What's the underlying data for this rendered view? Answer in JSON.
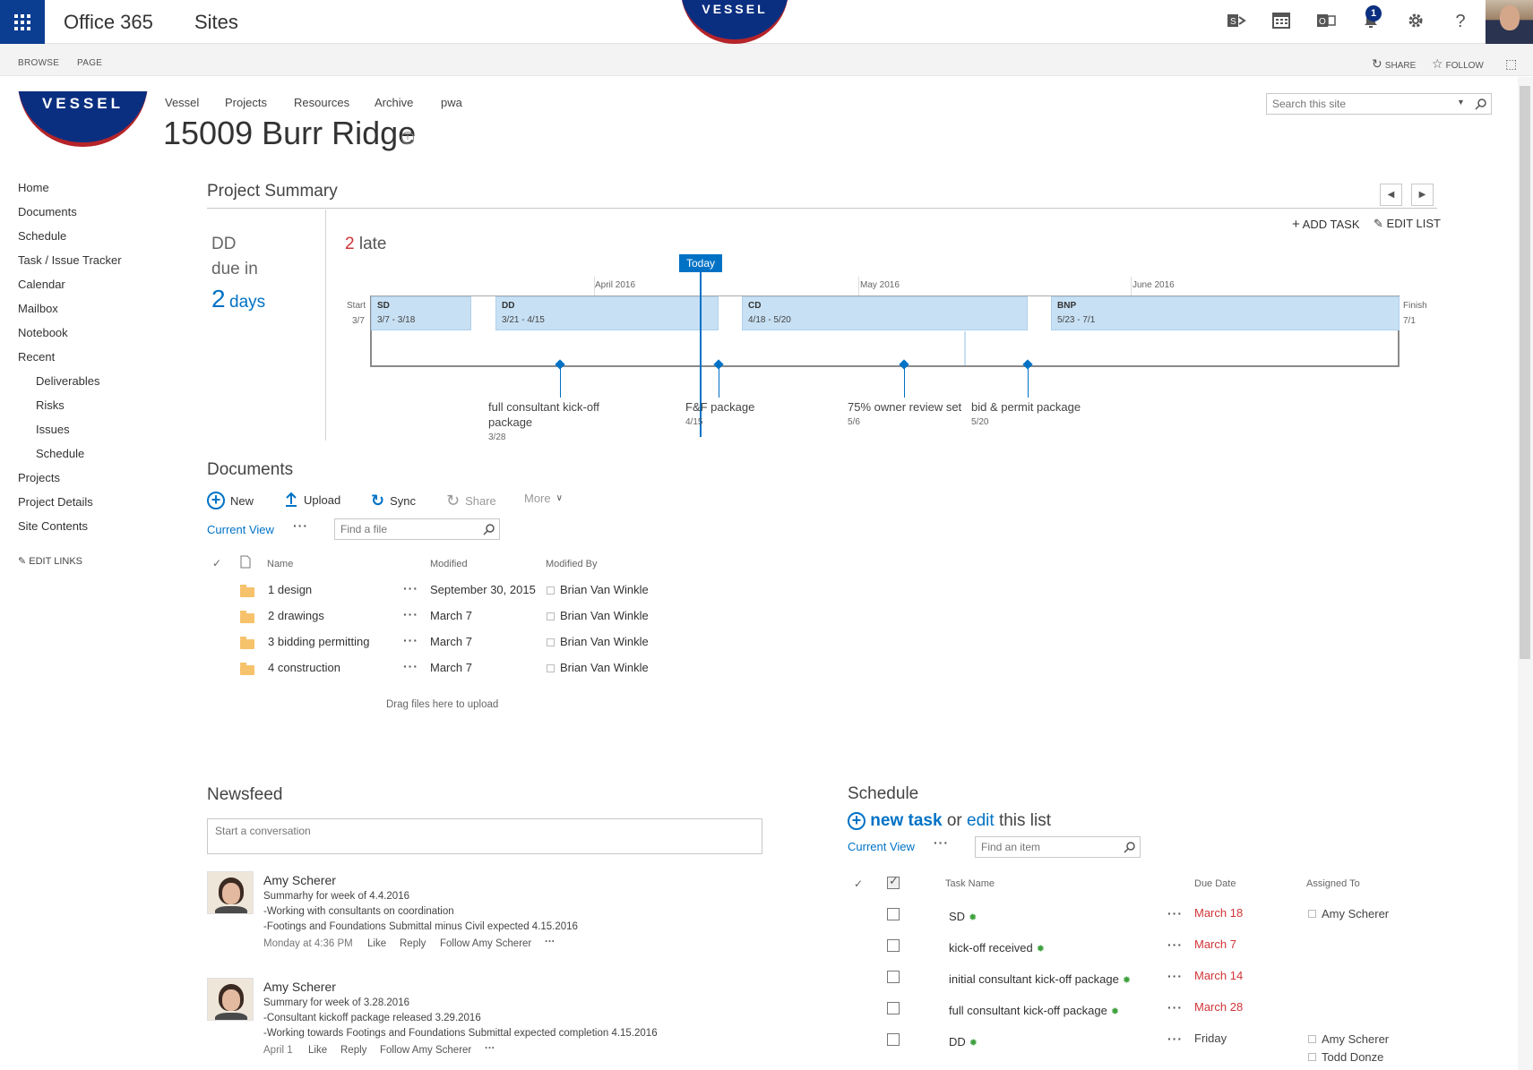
{
  "suite": {
    "app_name": "Office 365",
    "section": "Sites",
    "logo_text": "VESSEL",
    "notifications_count": "1",
    "icons": [
      "sharepoint-icon",
      "calendar-icon",
      "outlook-icon",
      "bell-icon",
      "gear-icon",
      "help-icon"
    ]
  },
  "ribbon": {
    "tabs": [
      "BROWSE",
      "PAGE"
    ],
    "share": "SHARE",
    "follow": "FOLLOW"
  },
  "header": {
    "logo_text": "VESSEL",
    "top_nav": [
      "Vessel",
      "Projects",
      "Resources",
      "Archive",
      "pwa"
    ],
    "site_title": "15009 Burr Ridge",
    "search_placeholder": "Search this site"
  },
  "quick_launch": {
    "items": [
      "Home",
      "Documents",
      "Schedule",
      "Task / Issue Tracker",
      "Calendar",
      "Mailbox",
      "Notebook",
      "Recent"
    ],
    "recent_items": [
      "Deliverables",
      "Risks",
      "Issues",
      "Schedule"
    ],
    "bottom_items": [
      "Projects",
      "Project Details",
      "Site Contents"
    ],
    "edit_links": "EDIT LINKS"
  },
  "project_summary": {
    "title": "Project Summary",
    "due_phase": "DD",
    "due_label": "due in",
    "due_number": "2",
    "due_unit": "days",
    "late_count": "2",
    "late_label": "late",
    "add_task": "ADD TASK",
    "edit_list": "EDIT LIST",
    "today_label": "Today",
    "months": [
      "April 2016",
      "May 2016",
      "June 2016"
    ],
    "start_label": "Start",
    "start_date": "3/7",
    "finish_label": "Finish",
    "finish_date": "7/1",
    "phases": [
      {
        "name": "SD",
        "dates": "3/7 - 3/18"
      },
      {
        "name": "DD",
        "dates": "3/21 - 4/15"
      },
      {
        "name": "CD",
        "dates": "4/18 - 5/20"
      },
      {
        "name": "BNP",
        "dates": "5/23 - 7/1"
      }
    ],
    "milestones": [
      {
        "label_1": "full consultant kick-off",
        "label_2": "package",
        "date": "3/28"
      },
      {
        "label_1": "F&F package",
        "date": "4/15"
      },
      {
        "label_1": "75% owner review set",
        "date": "5/6"
      },
      {
        "label_1": "bid & permit package",
        "date": "5/20"
      }
    ]
  },
  "documents": {
    "title": "Documents",
    "commands": [
      "New",
      "Upload",
      "Sync",
      "Share",
      "More"
    ],
    "current_view": "Current View",
    "find_placeholder": "Find a file",
    "columns": [
      "Name",
      "Modified",
      "Modified By"
    ],
    "rows": [
      {
        "name": "1 design",
        "modified": "September 30, 2015",
        "modified_by": "Brian Van Winkle"
      },
      {
        "name": "2 drawings",
        "modified": "March 7",
        "modified_by": "Brian Van Winkle"
      },
      {
        "name": "3 bidding permitting",
        "modified": "March 7",
        "modified_by": "Brian Van Winkle"
      },
      {
        "name": "4 construction",
        "modified": "March 7",
        "modified_by": "Brian Van Winkle"
      }
    ],
    "drag_hint": "Drag files here to upload"
  },
  "newsfeed": {
    "title": "Newsfeed",
    "placeholder": "Start a conversation",
    "posts": [
      {
        "author": "Amy Scherer",
        "lines": [
          "Summarhy for week of 4.4.2016",
          "-Working with consultants on coordination",
          "-Footings and Foundations Submittal minus Civil expected 4.15.2016"
        ],
        "time": "Monday at 4:36 PM",
        "like": "Like",
        "reply": "Reply",
        "follow": "Follow Amy Scherer"
      },
      {
        "author": "Amy Scherer",
        "lines": [
          "Summary for week of 3.28.2016",
          "-Consultant kickoff package released 3.29.2016",
          "-Working towards Footings and Foundations Submittal expected completion 4.15.2016"
        ],
        "time": "April 1",
        "like": "Like",
        "reply": "Reply",
        "follow": "Follow Amy Scherer"
      }
    ]
  },
  "schedule": {
    "title": "Schedule",
    "new_task": "new task",
    "or": "or",
    "edit": "edit",
    "this_list": "this list",
    "current_view": "Current View",
    "find_placeholder": "Find an item",
    "columns": [
      "Task Name",
      "Due Date",
      "Assigned To"
    ],
    "tasks": [
      {
        "name": "SD",
        "due": "March 18",
        "assigned": [
          "Amy Scherer"
        ]
      },
      {
        "name": "kick-off received",
        "due": "March 7",
        "assigned": []
      },
      {
        "name": "initial consultant kick-off package",
        "due": "March 14",
        "assigned": []
      },
      {
        "name": "full consultant kick-off package",
        "due": "March 28",
        "assigned": []
      },
      {
        "name": "DD",
        "due": "Friday",
        "assigned": [
          "Amy Scherer",
          "Todd Donze"
        ]
      }
    ],
    "overdue_color": "#d13438"
  },
  "colors": {
    "brand_blue": "#0b2f80",
    "accent": "#0072c6",
    "phase_fill": "#c7e0f4"
  }
}
